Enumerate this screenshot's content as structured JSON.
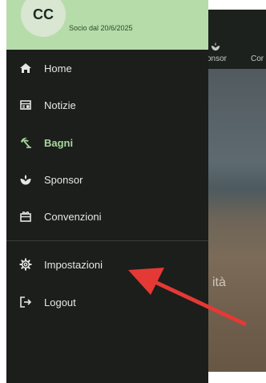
{
  "header": {
    "avatar_initials": "CC",
    "member_since": "Socio dal 20/6/2025"
  },
  "background": {
    "tabs": [
      "onsor",
      "Cor"
    ],
    "photo_caption": "ità"
  },
  "menu": {
    "items": [
      {
        "label": "Home",
        "icon": "home-icon",
        "active": false
      },
      {
        "label": "Notizie",
        "icon": "news-icon",
        "active": false
      },
      {
        "label": "Bagni",
        "icon": "beach-umbrella-icon",
        "active": true
      },
      {
        "label": "Sponsor",
        "icon": "sponsor-icon",
        "active": false
      },
      {
        "label": "Convenzioni",
        "icon": "gift-icon",
        "active": false
      }
    ],
    "secondary": [
      {
        "label": "Impostazioni",
        "icon": "gear-icon"
      },
      {
        "label": "Logout",
        "icon": "logout-icon"
      }
    ]
  },
  "colors": {
    "drawer_bg": "#1b1e1b",
    "header_bg": "#b6dcaa",
    "active_text": "#a9d69d",
    "annotation_arrow": "#e53935"
  }
}
